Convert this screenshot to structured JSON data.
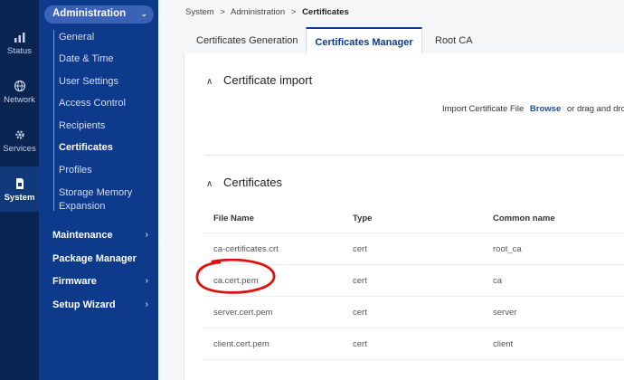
{
  "rail": {
    "items": [
      {
        "label": "Status",
        "icon": "status-bars-icon"
      },
      {
        "label": "Network",
        "icon": "globe-icon"
      },
      {
        "label": "Services",
        "icon": "gear-icon"
      },
      {
        "label": "System",
        "icon": "system-chip-icon"
      }
    ],
    "active": "System"
  },
  "sidebar": {
    "section": "Administration",
    "sub_items": [
      "General",
      "Date & Time",
      "User Settings",
      "Access Control",
      "Recipients",
      "Certificates",
      "Profiles",
      "Storage Memory",
      "Expansion"
    ],
    "active_sub": "Certificates",
    "main_items": [
      "Maintenance",
      "Package Manager",
      "Firmware",
      "Setup Wizard"
    ]
  },
  "breadcrumb": {
    "items": [
      "System",
      "Administration"
    ],
    "separator": ">",
    "current": "Certificates"
  },
  "tabs": [
    "Certificates Generation",
    "Certificates Manager",
    "Root CA"
  ],
  "active_tab": "Certificates Manager",
  "import": {
    "title": "Certificate import",
    "label": "Import Certificate File",
    "browse": "Browse",
    "drag": "or drag and drop"
  },
  "certificates": {
    "title": "Certificates",
    "columns": [
      "File Name",
      "Type",
      "Common name"
    ],
    "rows": [
      {
        "file": "ca-certificates.crt",
        "type": "cert",
        "common": "root_ca"
      },
      {
        "file": "ca.cert.pem",
        "type": "cert",
        "common": "ca"
      },
      {
        "file": "server.cert.pem",
        "type": "cert",
        "common": "server"
      },
      {
        "file": "client.cert.pem",
        "type": "cert",
        "common": "client"
      }
    ]
  },
  "colors": {
    "rail": "#0b2552",
    "sidebar": "#0e3a8c",
    "accent": "#0e3a8c",
    "annotation": "#e01010"
  }
}
